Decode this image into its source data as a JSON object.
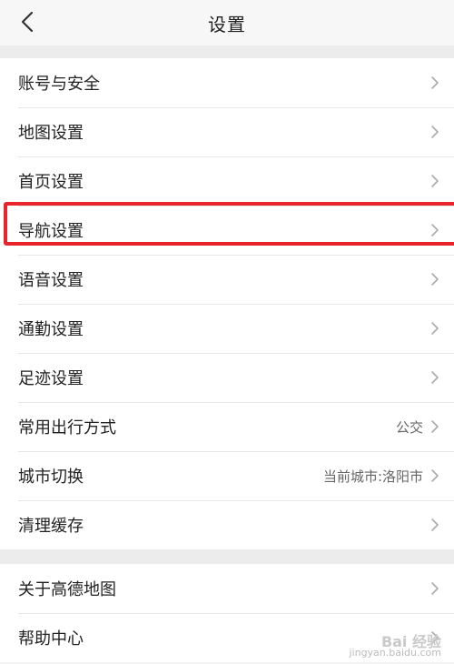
{
  "header": {
    "title": "设置",
    "back_icon": "chevron-left-icon"
  },
  "group1": [
    {
      "label": "账号与安全",
      "value": ""
    },
    {
      "label": "地图设置",
      "value": ""
    },
    {
      "label": "首页设置",
      "value": ""
    },
    {
      "label": "导航设置",
      "value": "",
      "highlighted": true
    },
    {
      "label": "语音设置",
      "value": ""
    },
    {
      "label": "通勤设置",
      "value": ""
    },
    {
      "label": "足迹设置",
      "value": ""
    },
    {
      "label": "常用出行方式",
      "value": "公交"
    },
    {
      "label": "城市切换",
      "value": "当前城市:洛阳市"
    },
    {
      "label": "清理缓存",
      "value": ""
    }
  ],
  "group2": [
    {
      "label": "关于高德地图",
      "value": ""
    },
    {
      "label": "帮助中心",
      "value": ""
    }
  ],
  "watermark": {
    "main": "Bai 经验",
    "sub": "jingyan.baidu.com"
  },
  "colors": {
    "highlight": "#e8232b",
    "chevron": "#aaaaaa"
  }
}
